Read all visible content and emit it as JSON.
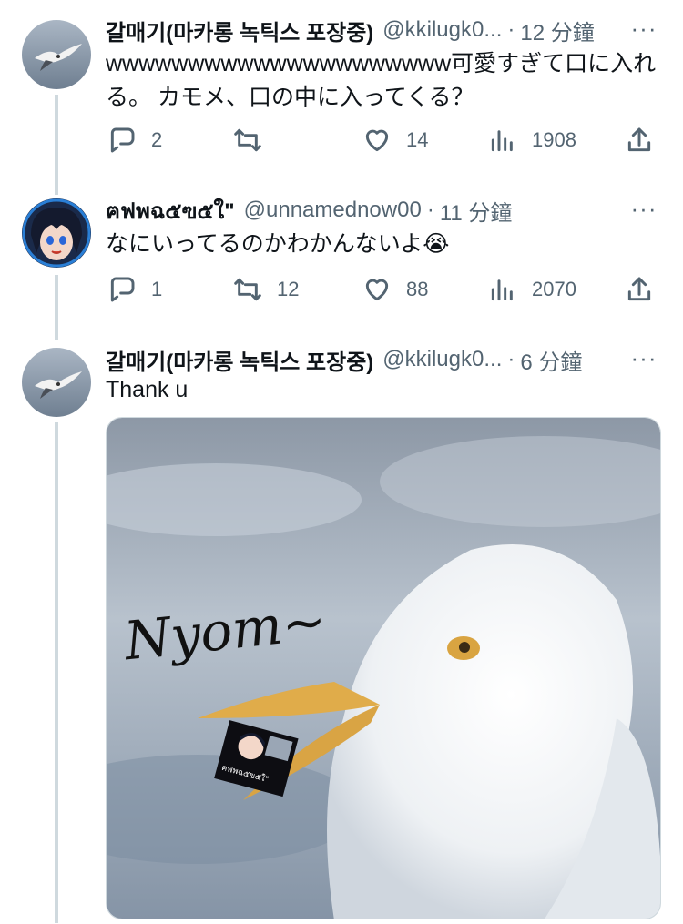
{
  "tweets": [
    {
      "name": "갈매기(마카롱 녹틱스 포장중)",
      "handle": "@kkilugk0...",
      "dot": "·",
      "time": "12 分鐘",
      "text": "wwwwwwwwwwwwwwwwwwwww可愛すぎて口に入れる。 カモメ、口の中に入ってくる？",
      "actions": {
        "replies": "2",
        "retweets": "",
        "likes": "14",
        "views": "1908"
      }
    },
    {
      "name": "ฅฟพฉ๕ฃ๕ใ\"",
      "handle": "@unnamednow00",
      "dot": "·",
      "time": "11 分鐘",
      "text": "なにいってるのかわかんないよ😭",
      "actions": {
        "replies": "1",
        "retweets": "12",
        "likes": "88",
        "views": "2070"
      }
    },
    {
      "name": "갈매기(마카롱 녹틱스 포장중)",
      "handle": "@kkilugk0...",
      "dot": "·",
      "time": "6 分鐘",
      "text": "Thank u",
      "media": {
        "drawn_text": "Nyom~",
        "sticker_text": "ฅฟพฉ๕ฃ๕ใ\""
      }
    }
  ],
  "icons": {
    "more": "more-horizontal-icon",
    "reply": "reply-icon",
    "retweet": "retweet-icon",
    "like": "heart-icon",
    "views": "views-icon",
    "share": "share-icon"
  },
  "colors": {
    "text": "#0f1419",
    "secondary": "#536471",
    "thread_line": "#cfd9de"
  }
}
